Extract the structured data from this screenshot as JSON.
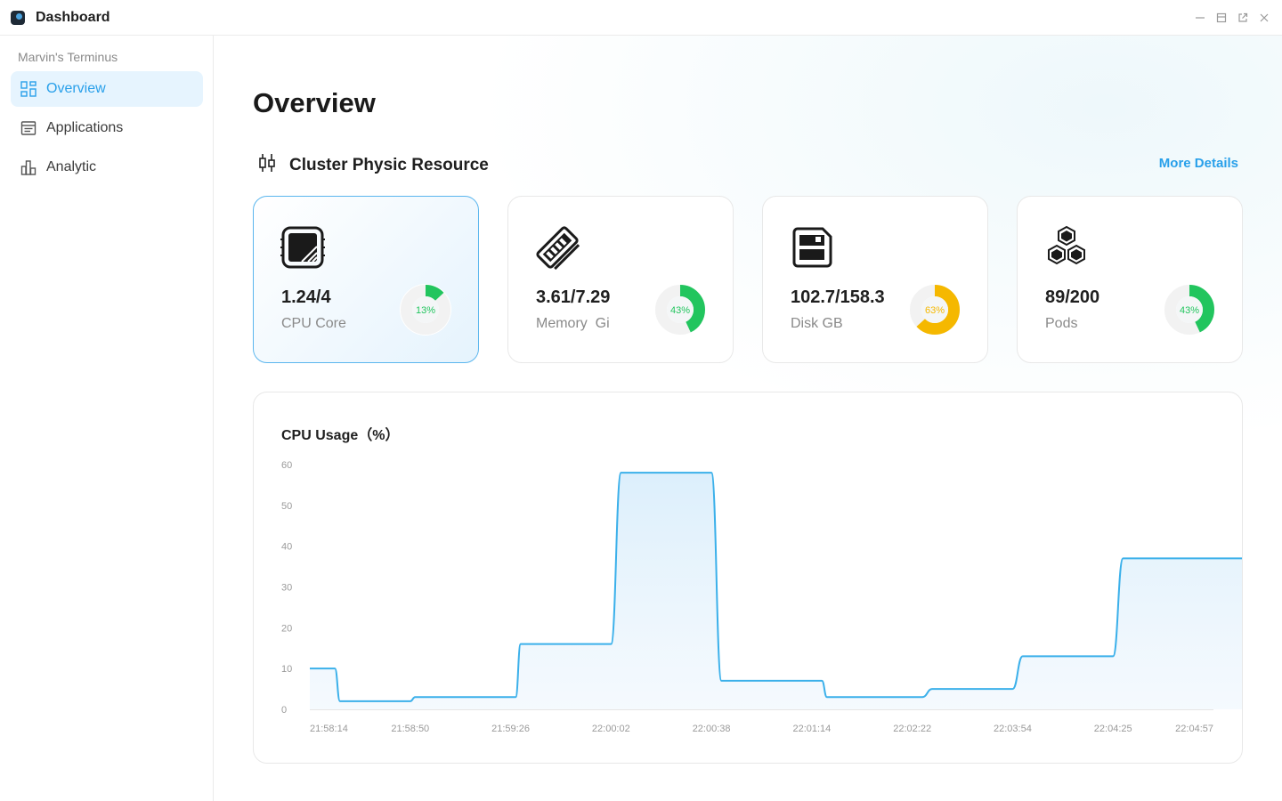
{
  "window": {
    "title": "Dashboard",
    "controls": [
      "minimize-icon",
      "maximize-icon",
      "popout-icon",
      "close-icon"
    ]
  },
  "sidebar": {
    "workspace": "Marvin's Terminus",
    "items": [
      {
        "label": "Overview",
        "icon": "overview-grid-icon",
        "active": true
      },
      {
        "label": "Applications",
        "icon": "applications-icon",
        "active": false
      },
      {
        "label": "Analytic",
        "icon": "analytic-bars-icon",
        "active": false
      }
    ]
  },
  "main": {
    "title": "Overview",
    "section_title": "Cluster Physic Resource",
    "section_icon": "resource-sliders-icon",
    "more_details": "More Details",
    "cards": [
      {
        "value": "1.24/4",
        "label": "CPU Core",
        "percent": 13,
        "percent_label": "13%",
        "color": "#22c55e",
        "icon": "cpu-icon",
        "selected": true
      },
      {
        "value": "3.61/7.29",
        "label": "Memory  Gi",
        "percent": 43,
        "percent_label": "43%",
        "color": "#22c55e",
        "icon": "memory-icon",
        "selected": false
      },
      {
        "value": "102.7/158.3",
        "label": "Disk GB",
        "percent": 63,
        "percent_label": "63%",
        "color": "#f5b800",
        "icon": "disk-icon",
        "selected": false
      },
      {
        "value": "89/200",
        "label": "Pods",
        "percent": 43,
        "percent_label": "43%",
        "color": "#22c55e",
        "icon": "pods-icon",
        "selected": false
      }
    ]
  },
  "chart_data": {
    "type": "area",
    "title": "CPU Usage（%）",
    "xlabel": "",
    "ylabel": "",
    "ylim": [
      0,
      60
    ],
    "y_ticks": [
      0,
      10,
      20,
      30,
      40,
      50,
      60
    ],
    "x_tick_labels": [
      "21:58:14",
      "21:58:50",
      "21:59:26",
      "22:00:02",
      "22:00:38",
      "22:01:14",
      "22:02:22",
      "22:03:54",
      "22:04:25",
      "22:04:57"
    ],
    "line_color": "#3bb0ea",
    "grid": false,
    "series": [
      {
        "x": [
          0,
          0.25,
          0.3,
          1.0,
          1.05,
          2.05,
          2.1,
          3.0,
          3.1,
          4.0,
          4.1,
          5.1,
          5.15,
          6.1,
          6.2,
          7.0,
          7.1,
          8.0,
          8.1,
          9.0,
          9.1,
          9.45
        ],
        "values": [
          10,
          10,
          2,
          2,
          3,
          3,
          16,
          16,
          58,
          58,
          7,
          7,
          3,
          3,
          5,
          5,
          13,
          13,
          37,
          37,
          37,
          37
        ]
      }
    ]
  }
}
